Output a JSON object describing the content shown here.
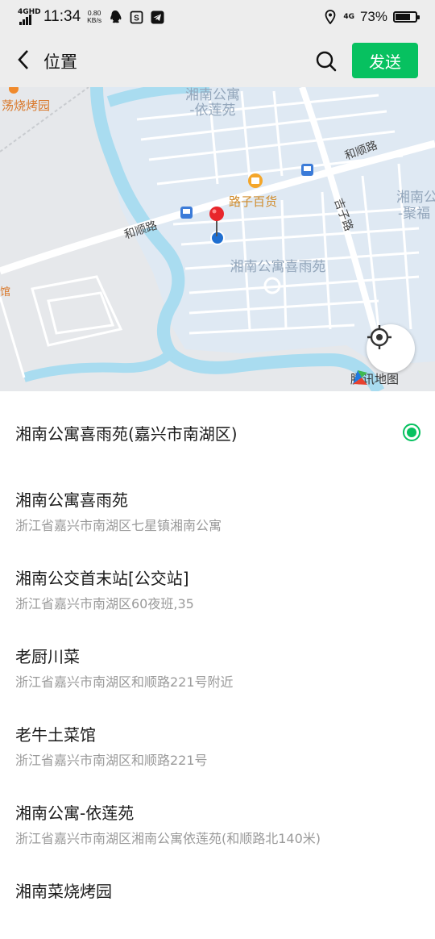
{
  "status_bar": {
    "network": "4GHD",
    "time": "11:34",
    "speed_value": "0.80",
    "speed_unit": "KB/s",
    "network_right": "4G",
    "battery": "73%",
    "battery_level": 0.73
  },
  "nav": {
    "title": "位置",
    "send_label": "发送"
  },
  "map": {
    "labels": {
      "bbq": "荡烧烤园",
      "apt_yilian_1": "湘南公寓",
      "apt_yilian_2": "-依莲苑",
      "road_heshun_right": "和顺路",
      "road_heshun_left": "和顺路",
      "store": "路子百货",
      "road_jizi": "吉子路",
      "apt_ju_1": "湘南公",
      "apt_ju_2": "-聚福",
      "apt_xiyu": "湘南公寓喜雨苑"
    },
    "attribution": "腾讯地图"
  },
  "selected": {
    "title": "湘南公寓喜雨苑(嘉兴市南湖区)"
  },
  "places": [
    {
      "name": "湘南公寓喜雨苑",
      "address": "浙江省嘉兴市南湖区七星镇湘南公寓"
    },
    {
      "name": "湘南公交首末站[公交站]",
      "address": "浙江省嘉兴市南湖区60夜班,35"
    },
    {
      "name": "老厨川菜",
      "address": "浙江省嘉兴市南湖区和顺路221号附近"
    },
    {
      "name": "老牛土菜馆",
      "address": "浙江省嘉兴市南湖区和顺路221号"
    },
    {
      "name": "湘南公寓-依莲苑",
      "address": "浙江省嘉兴市南湖区湘南公寓依莲苑(和顺路北140米)"
    },
    {
      "name": "湘南菜烧烤园",
      "address": ""
    }
  ],
  "colors": {
    "accent": "#07c160",
    "water": "#a9dcf0",
    "block": "#dde8f2",
    "pin": "#e8262b",
    "locator": "#1f6fd1"
  }
}
